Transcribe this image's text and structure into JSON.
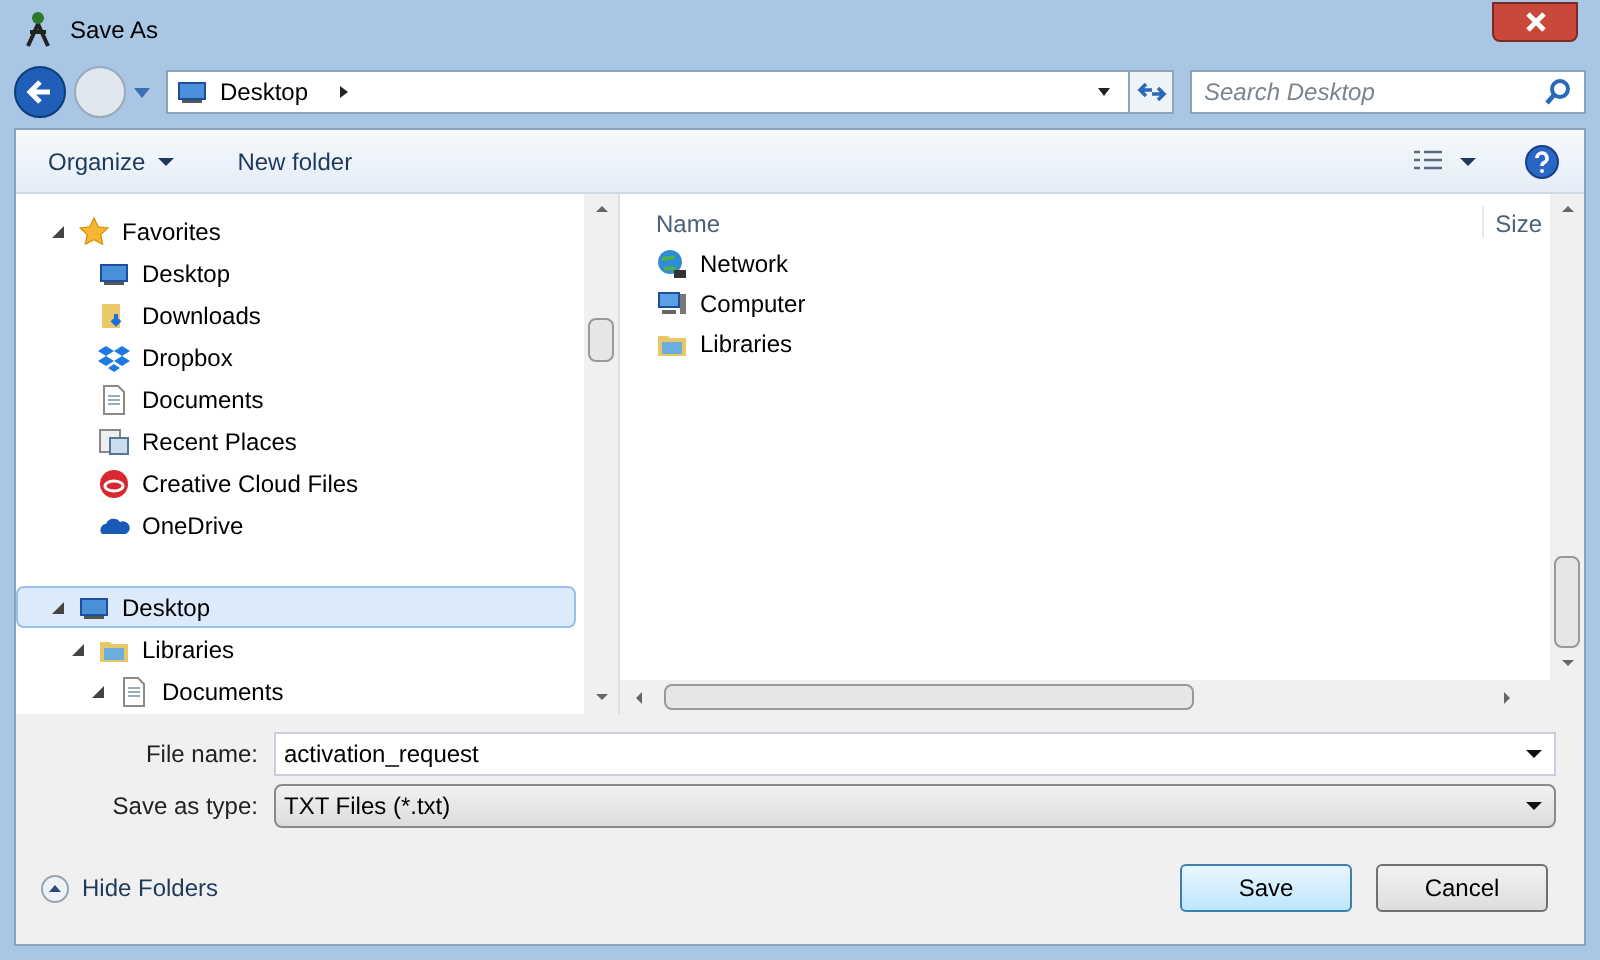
{
  "window": {
    "title": "Save As"
  },
  "address": {
    "location": "Desktop",
    "search_placeholder": "Search Desktop"
  },
  "toolbar": {
    "organize": "Organize",
    "new_folder": "New folder"
  },
  "tree": [
    {
      "label": "Favorites",
      "kind": "star",
      "expanded": true,
      "selected": false,
      "children": [
        {
          "label": "Desktop",
          "kind": "desktop",
          "selected": false
        },
        {
          "label": "Downloads",
          "kind": "downloads",
          "selected": false
        },
        {
          "label": "Dropbox",
          "kind": "dropbox",
          "selected": false
        },
        {
          "label": "Documents",
          "kind": "document",
          "selected": false
        },
        {
          "label": "Recent Places",
          "kind": "recent",
          "selected": false
        },
        {
          "label": "Creative Cloud Files",
          "kind": "cloudfiles",
          "selected": false
        },
        {
          "label": "OneDrive",
          "kind": "onedrive",
          "selected": false
        }
      ]
    },
    {
      "label": "Desktop",
      "kind": "desktop",
      "expanded": true,
      "selected": true,
      "children": [
        {
          "label": "Libraries",
          "kind": "library",
          "expanded": true,
          "selected": false,
          "children": [
            {
              "label": "Documents",
              "kind": "document",
              "expanded": true,
              "selected": false
            }
          ]
        }
      ]
    }
  ],
  "file_list": {
    "columns": [
      "Name",
      "Size"
    ],
    "items": [
      {
        "name": "Network",
        "kind": "network"
      },
      {
        "name": "Computer",
        "kind": "computer"
      },
      {
        "name": "Libraries",
        "kind": "library"
      }
    ]
  },
  "file_name": {
    "label": "File name:",
    "value": "activation_request"
  },
  "save_as_type": {
    "label": "Save as type:",
    "value": "TXT Files (*.txt)"
  },
  "hide_folders": "Hide Folders",
  "buttons": {
    "save": "Save",
    "cancel": "Cancel"
  }
}
